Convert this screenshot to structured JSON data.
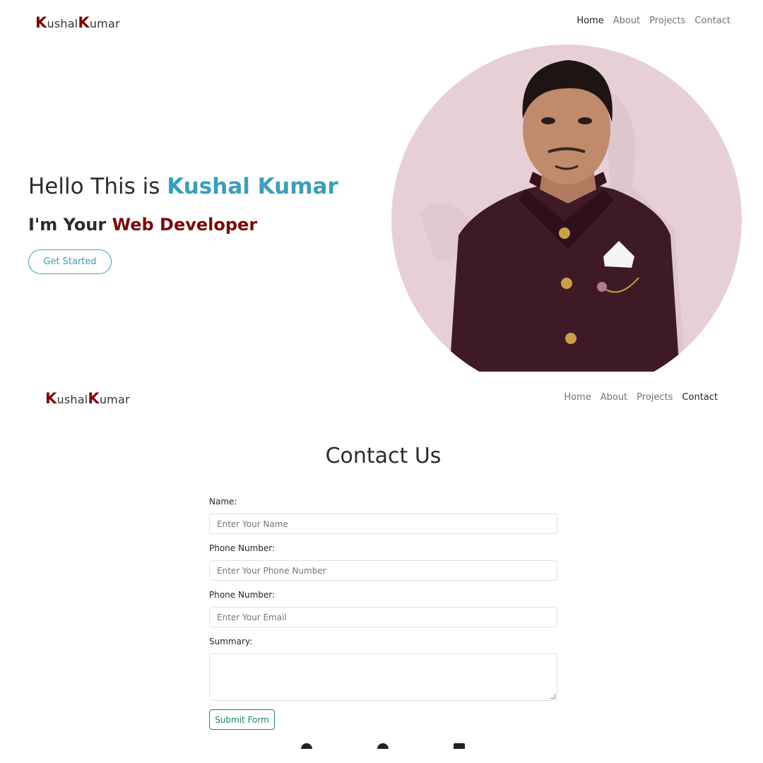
{
  "brand": {
    "k1": "K",
    "part1": "ushal",
    "k2": "K",
    "part2": "umar"
  },
  "nav_top": {
    "home": "Home",
    "about": "About",
    "projects": "Projects",
    "contact": "Contact",
    "active": "Home"
  },
  "hero": {
    "greeting": "Hello This is ",
    "name": "Kushal Kumar",
    "sub_prefix": "I'm Your ",
    "role": "Web Developer",
    "cta": "Get Started"
  },
  "nav_bottom": {
    "home": "Home",
    "about": "About",
    "projects": "Projects",
    "contact": "Contact",
    "active": "Contact"
  },
  "contact": {
    "title": "Contact Us",
    "name_label": "Name:",
    "name_placeholder": "Enter Your Name",
    "phone_label": "Phone Number:",
    "phone_placeholder": "Enter Your Phone Number",
    "email_label": "Phone Number:",
    "email_placeholder": "Enter Your Email",
    "summary_label": "Summary:",
    "submit": "Submit Form"
  },
  "colors": {
    "accent_blue": "#3a9fba",
    "accent_maroon": "#7a0a0a",
    "submit_green": "#198754"
  }
}
